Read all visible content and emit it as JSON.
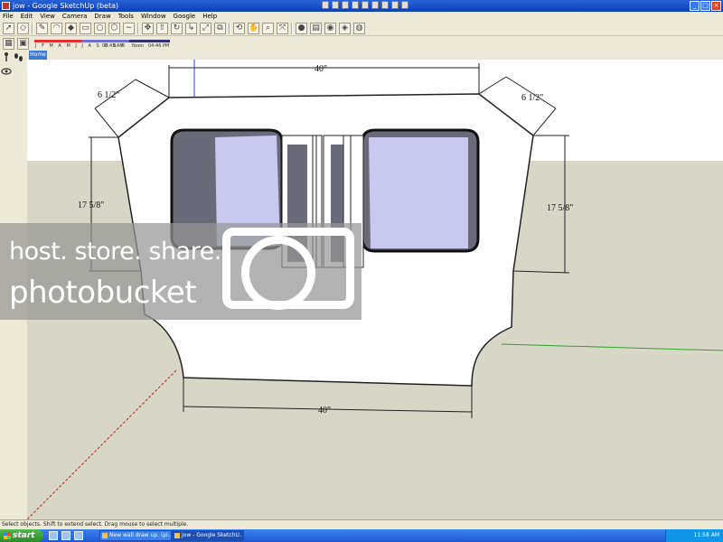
{
  "window": {
    "title": "jow - Google SketchUp (beta)",
    "buttons": [
      "_",
      "□",
      "×"
    ]
  },
  "menu": [
    "File",
    "Edit",
    "View",
    "Camera",
    "Draw",
    "Tools",
    "Window",
    "Google",
    "Help"
  ],
  "shadows": {
    "months": "J F M A M J J A S O N D",
    "time_start": "06:43 AM",
    "noon": "Noon",
    "time_end": "04:46 PM"
  },
  "tabs": [
    {
      "label": "Home"
    }
  ],
  "drawing": {
    "dim_top": "40\"",
    "dim_bottom": "40\"",
    "dim_left_corner": "6 1/2\"",
    "dim_right_corner": "6 1/2\"",
    "dim_left_height": "17  5/8\"",
    "dim_right_height": "17  5/8\""
  },
  "watermark": {
    "line1": "host. store. share.",
    "line2": "photobucket"
  },
  "status_text": "Select objects. Shift to extend select. Drag mouse to select multiple.",
  "taskbar": {
    "start": "start",
    "tasks": [
      "New wall draw up. (pi...",
      "jow - Google SketchU..."
    ],
    "clock": "11:58 AM"
  },
  "colors": {
    "sky": "#ffffff",
    "ground": "#d8d6c6",
    "window_glass": "#c8c8f0",
    "dark_face": "#6a6a78",
    "axis_red": "#a03030",
    "axis_green": "#30a030",
    "axis_blue": "#3040c0"
  }
}
